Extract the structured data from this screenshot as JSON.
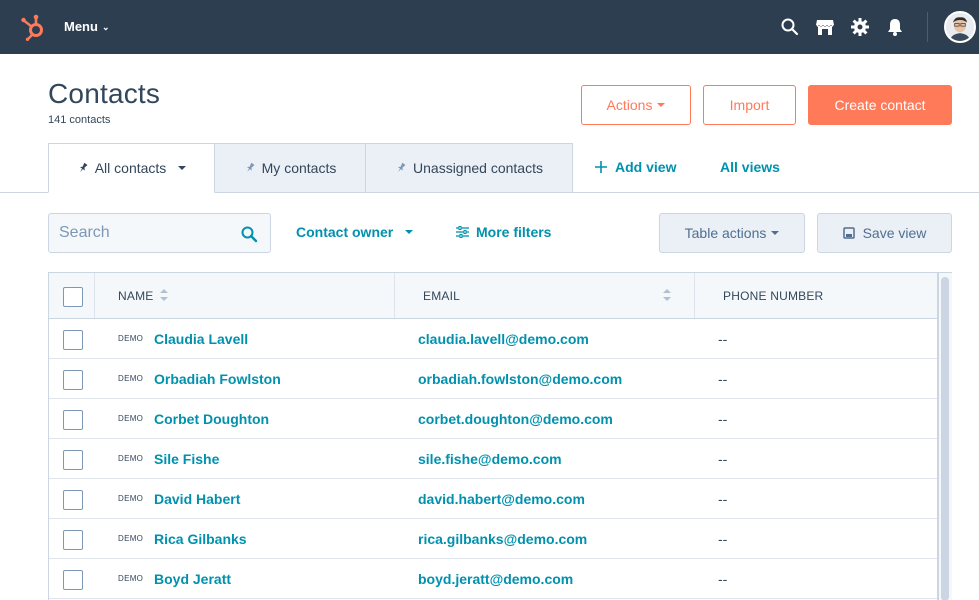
{
  "nav": {
    "menu_label": "Menu",
    "icons": [
      "hubspot-logo",
      "search-icon",
      "marketplace-icon",
      "settings-icon",
      "notifications-icon",
      "avatar"
    ]
  },
  "header": {
    "title": "Contacts",
    "count": "141 contacts",
    "actions_label": "Actions",
    "import_label": "Import",
    "create_label": "Create contact"
  },
  "tabs": [
    {
      "label": "All contacts",
      "active": true
    },
    {
      "label": "My contacts",
      "active": false
    },
    {
      "label": "Unassigned contacts",
      "active": false
    }
  ],
  "tab_links": {
    "add_view": "Add view",
    "all_views": "All views"
  },
  "filters": {
    "search_placeholder": "Search",
    "contact_owner": "Contact owner",
    "more_filters": "More filters",
    "table_actions": "Table actions",
    "save_view": "Save view"
  },
  "table": {
    "columns": [
      "NAME",
      "EMAIL",
      "PHONE NUMBER"
    ],
    "rows": [
      {
        "badge": "DEMO",
        "name": "Claudia Lavell",
        "email": "claudia.lavell@demo.com",
        "phone": "--"
      },
      {
        "badge": "DEMO",
        "name": "Orbadiah Fowlston",
        "email": "orbadiah.fowlston@demo.com",
        "phone": "--"
      },
      {
        "badge": "DEMO",
        "name": "Corbet Doughton",
        "email": "corbet.doughton@demo.com",
        "phone": "--"
      },
      {
        "badge": "DEMO",
        "name": "Sile Fishe",
        "email": "sile.fishe@demo.com",
        "phone": "--"
      },
      {
        "badge": "DEMO",
        "name": "David Habert",
        "email": "david.habert@demo.com",
        "phone": "--"
      },
      {
        "badge": "DEMO",
        "name": "Rica Gilbanks",
        "email": "rica.gilbanks@demo.com",
        "phone": "--"
      },
      {
        "badge": "DEMO",
        "name": "Boyd Jeratt",
        "email": "boyd.jeratt@demo.com",
        "phone": "--"
      }
    ]
  },
  "colors": {
    "nav_bg": "#2d3e50",
    "brand_orange": "#ff7a59",
    "link_teal": "#0091ae",
    "text_dark": "#33475b"
  }
}
